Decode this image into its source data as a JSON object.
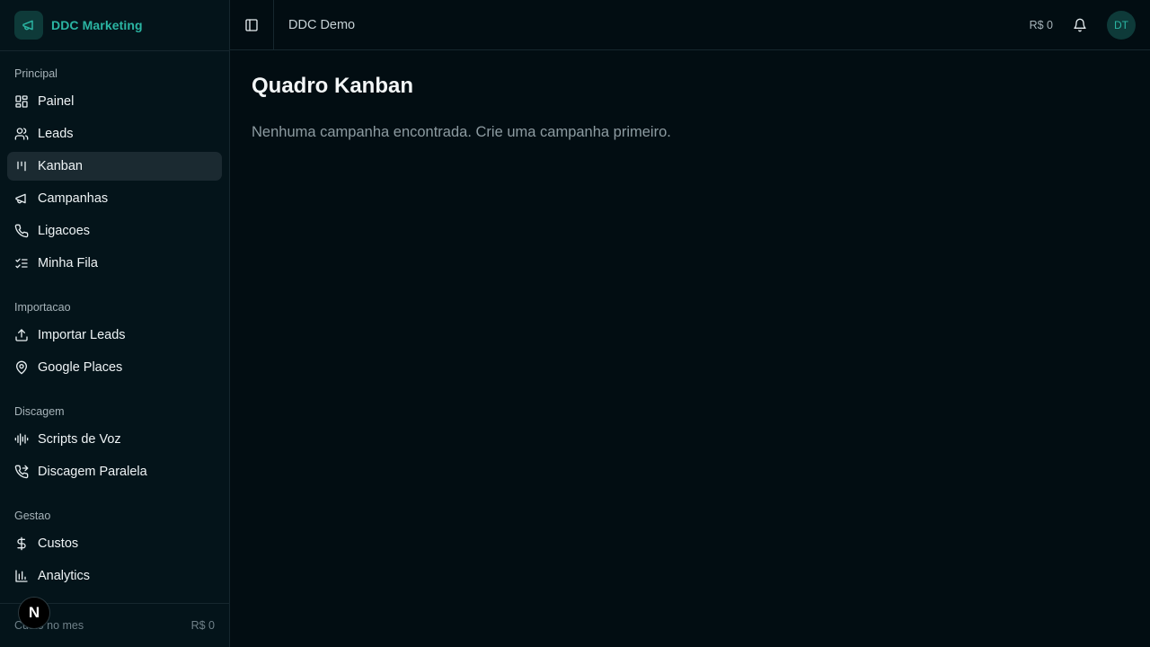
{
  "brand": {
    "name": "DDC Marketing"
  },
  "sidebar": {
    "groups": [
      {
        "label": "Principal",
        "items": [
          {
            "label": "Painel",
            "icon": "layout-dashboard-icon"
          },
          {
            "label": "Leads",
            "icon": "users-icon"
          },
          {
            "label": "Kanban",
            "icon": "kanban-icon",
            "active": true
          },
          {
            "label": "Campanhas",
            "icon": "megaphone-icon"
          },
          {
            "label": "Ligacoes",
            "icon": "phone-icon"
          },
          {
            "label": "Minha Fila",
            "icon": "list-checks-icon"
          }
        ]
      },
      {
        "label": "Importacao",
        "items": [
          {
            "label": "Importar Leads",
            "icon": "upload-icon"
          },
          {
            "label": "Google Places",
            "icon": "map-pin-icon"
          }
        ]
      },
      {
        "label": "Discagem",
        "items": [
          {
            "label": "Scripts de Voz",
            "icon": "audio-lines-icon"
          },
          {
            "label": "Discagem Paralela",
            "icon": "phone-forwarded-icon"
          }
        ]
      },
      {
        "label": "Gestao",
        "items": [
          {
            "label": "Custos",
            "icon": "dollar-icon"
          },
          {
            "label": "Analytics",
            "icon": "bar-chart-icon"
          }
        ]
      }
    ],
    "footer": {
      "label": "Custo no mes",
      "value": "R$ 0"
    },
    "badge": "N"
  },
  "topbar": {
    "org": "DDC Demo",
    "cost": "R$ 0",
    "avatar": "DT"
  },
  "main": {
    "title": "Quadro Kanban",
    "empty_message": "Nenhuma campanha encontrada. Crie uma campanha primeiro."
  },
  "colors": {
    "accent": "#2bb5a3",
    "background": "#020d12",
    "sidebar": "#04141a"
  }
}
